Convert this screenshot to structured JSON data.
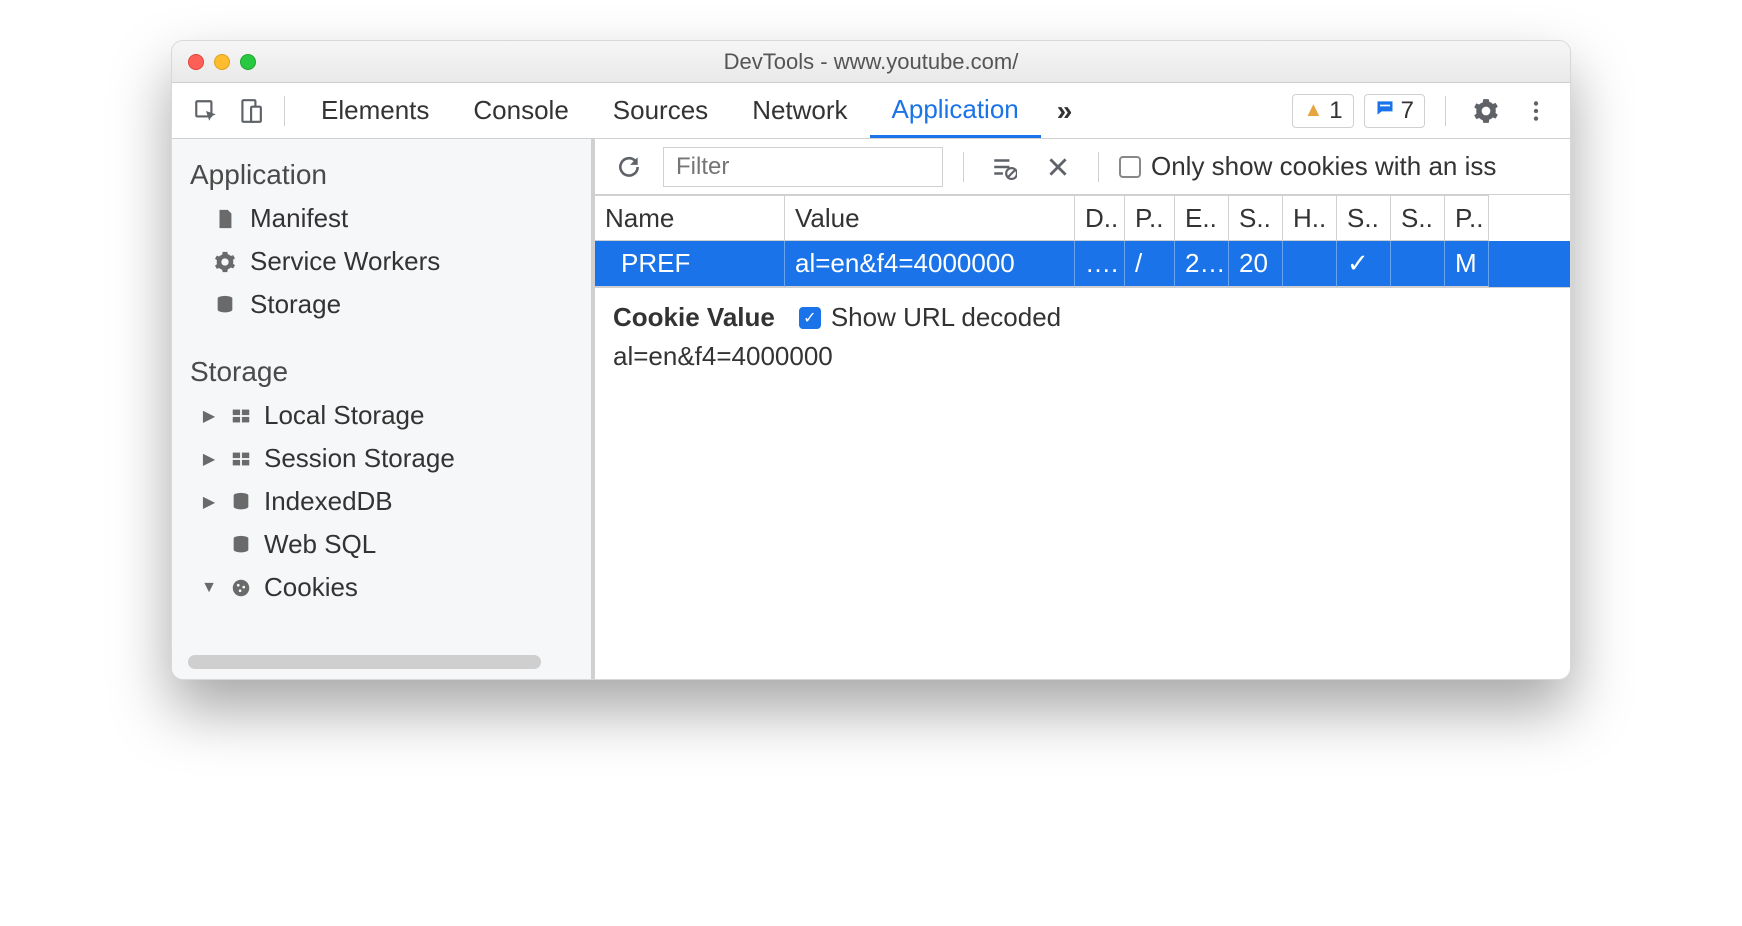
{
  "window": {
    "title": "DevTools - www.youtube.com/"
  },
  "tabs": {
    "items": [
      "Elements",
      "Console",
      "Sources",
      "Network",
      "Application"
    ],
    "active_index": 4,
    "more_glyph": "»"
  },
  "badges": {
    "warnings": "1",
    "messages": "7"
  },
  "sidebar": {
    "section1": {
      "title": "Application",
      "items": [
        {
          "label": "Manifest",
          "icon": "doc"
        },
        {
          "label": "Service Workers",
          "icon": "gear"
        },
        {
          "label": "Storage",
          "icon": "db"
        }
      ]
    },
    "section2": {
      "title": "Storage",
      "items": [
        {
          "label": "Local Storage",
          "icon": "grid",
          "twisty": "▶"
        },
        {
          "label": "Session Storage",
          "icon": "grid",
          "twisty": "▶"
        },
        {
          "label": "IndexedDB",
          "icon": "db",
          "twisty": "▶"
        },
        {
          "label": "Web SQL",
          "icon": "db",
          "twisty": ""
        },
        {
          "label": "Cookies",
          "icon": "cookie",
          "twisty": "▼"
        }
      ]
    }
  },
  "toolbar": {
    "filter_placeholder": "Filter",
    "only_issues_label": "Only show cookies with an iss"
  },
  "table": {
    "headers": [
      "Name",
      "Value",
      "D..",
      "P..",
      "E..",
      "S..",
      "H..",
      "S..",
      "S..",
      "P.."
    ],
    "widths": [
      190,
      290,
      50,
      50,
      54,
      54,
      54,
      54,
      54,
      44
    ],
    "rows": [
      {
        "selected": true,
        "cells": [
          "PREF",
          "al=en&f4=4000000",
          "….",
          "/",
          "2…",
          "20",
          "",
          "✓",
          "",
          "M"
        ]
      }
    ]
  },
  "detail": {
    "label": "Cookie Value",
    "checkbox_label": "Show URL decoded",
    "checkbox_checked": true,
    "value": "al=en&f4=4000000"
  }
}
